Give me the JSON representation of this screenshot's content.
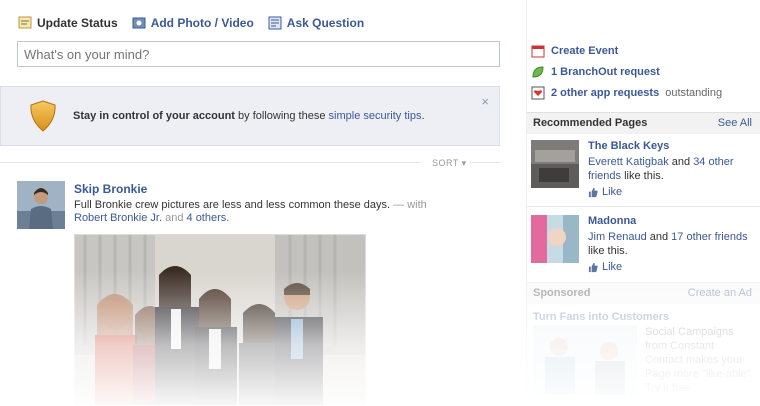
{
  "composer": {
    "tabs": [
      {
        "label": "Update Status",
        "icon": "status-icon"
      },
      {
        "label": "Add Photo / Video",
        "icon": "photo-icon"
      },
      {
        "label": "Ask Question",
        "icon": "question-icon"
      }
    ],
    "placeholder": "What's on your mind?"
  },
  "security_tip": {
    "bold_text": "Stay in control of your account",
    "text": " by following these ",
    "link": "simple security tips",
    "end": ".",
    "close": "×"
  },
  "feed": {
    "sort_label": "SORT ▾"
  },
  "story": {
    "author": "Skip Bronkie",
    "message": "Full Bronkie crew pictures are less and less common these days.",
    "with_prefix": " — with",
    "tagged": "Robert Bronkie Jr.",
    "and": " and ",
    "others": "4 others."
  },
  "sidebar": {
    "links": [
      {
        "label": "Create Event",
        "suffix": "",
        "icon": "calendar-icon"
      },
      {
        "label": "1 BranchOut request",
        "suffix": "",
        "icon": "leaf-icon"
      },
      {
        "label": "2 other app requests",
        "suffix": " outstanding",
        "icon": "app-request-icon"
      }
    ],
    "recommended": {
      "title": "Recommended Pages",
      "see_all": "See All",
      "pages": [
        {
          "name": "The Black Keys",
          "friend": "Everett Katigbak",
          "and": " and ",
          "others": "34 other friends",
          "tail": " like this.",
          "like": "Like"
        },
        {
          "name": "Madonna",
          "friend": "Jim Renaud",
          "and": " and ",
          "others": "17 other friends",
          "tail": " like this.",
          "like": "Like"
        }
      ]
    },
    "sponsored": {
      "title": "Sponsored",
      "create_ad": "Create an Ad",
      "ad_title": "Turn Fans into Customers",
      "ad_text": "Social Campaigns from Constant Contact makes your Page more \"like-able\". Try it free."
    }
  },
  "colors": {
    "link": "#3b5998",
    "tip_bg": "#edeff4",
    "header_bg": "#f2f2f2"
  }
}
